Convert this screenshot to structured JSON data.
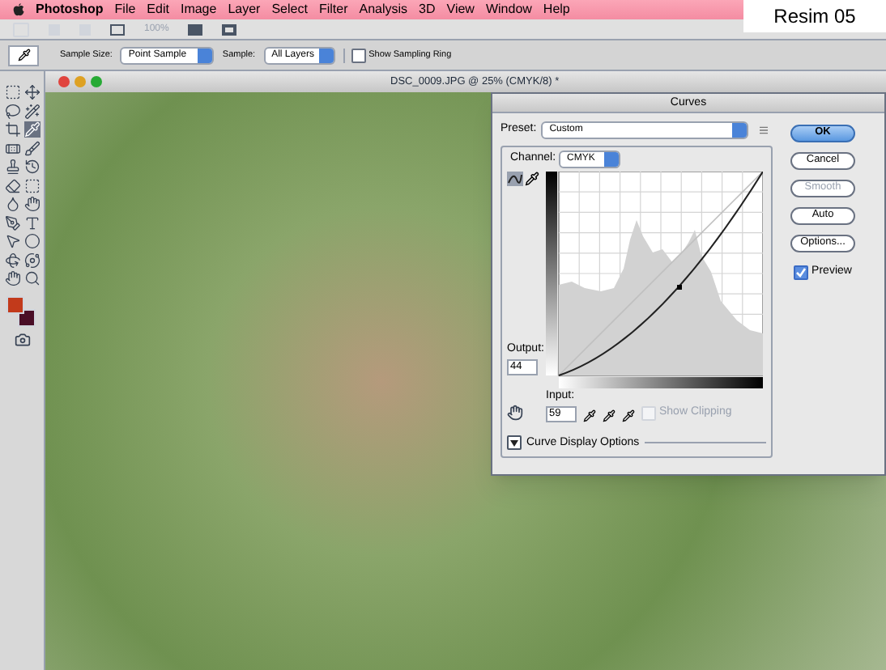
{
  "menu_bar": {
    "items": [
      "Photoshop",
      "File",
      "Edit",
      "Image",
      "Layer",
      "Select",
      "Filter",
      "Analysis",
      "3D",
      "View",
      "Window",
      "Help"
    ]
  },
  "label": "Resim 05",
  "app_bar": {
    "zoom": "100%"
  },
  "options_bar": {
    "sample_size_label": "Sample Size:",
    "sample_size": "Point Sample",
    "sample_label": "Sample:",
    "sample": "All Layers",
    "show_sampling_ring": {
      "label": "Show Sampling Ring",
      "checked": false
    }
  },
  "document": {
    "title": "DSC_0009.JPG @ 25% (CMYK/8) *"
  },
  "curves": {
    "title": "Curves",
    "preset_label": "Preset:",
    "preset": "Custom",
    "channel_label": "Channel:",
    "channel": "CMYK",
    "output_label": "Output:",
    "output": "44",
    "input_label": "Input:",
    "input": "59",
    "show_clipping": {
      "label": "Show Clipping",
      "checked": false,
      "disabled": true
    },
    "display_options": "Curve Display Options",
    "buttons": [
      {
        "label": "OK",
        "kind": "default",
        "disabled": false
      },
      {
        "label": "Cancel",
        "kind": "normal",
        "disabled": false
      },
      {
        "label": "Smooth",
        "kind": "normal",
        "disabled": true
      },
      {
        "label": "Auto",
        "kind": "normal",
        "disabled": false
      },
      {
        "label": "Options...",
        "kind": "normal",
        "disabled": false
      }
    ],
    "preview": {
      "label": "Preview",
      "checked": true
    }
  }
}
